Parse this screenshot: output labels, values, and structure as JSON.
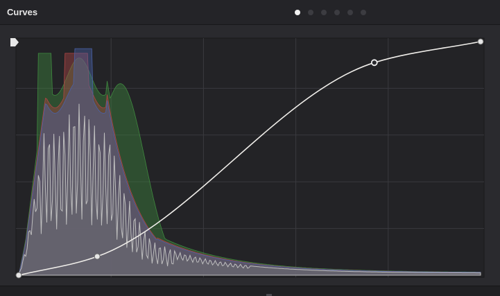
{
  "panel": {
    "title": "Curves",
    "page_dots": [
      {
        "active": true
      },
      {
        "active": false
      },
      {
        "active": false
      },
      {
        "active": false
      },
      {
        "active": false
      },
      {
        "active": false
      }
    ]
  },
  "curve": {
    "control_points": [
      [
        0.0,
        0.0
      ],
      [
        0.17,
        0.08
      ],
      [
        0.77,
        0.91
      ],
      [
        1.0,
        1.0
      ]
    ]
  },
  "colors": {
    "background": "#2a2a2e",
    "plot_background": "#232326",
    "grid": "#3a3a3f",
    "curve": "#f0eeea",
    "hist_luma": "#bfbfbf",
    "hist_red": "#b04545",
    "hist_green": "#3f8a3f",
    "hist_blue": "#4a62a8"
  }
}
